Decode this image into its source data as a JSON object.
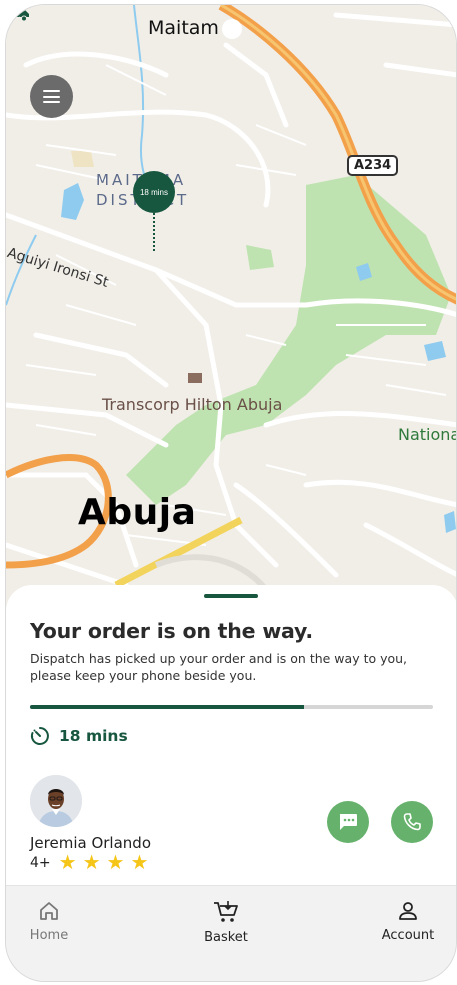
{
  "map": {
    "labels": {
      "maitam": "Maitam",
      "district": "MAITAMA\nDISTRICT",
      "street": "Aguiyi Ironsi St",
      "hotel": "Transcorp Hilton Abuja",
      "national": "Nationa",
      "city": "Abuja",
      "road_shield": "A234"
    },
    "eta_bubble": "18 mins",
    "menu_icon": "menu-icon",
    "courier_icon": "truck-icon"
  },
  "sheet": {
    "title": "Your order is on the way.",
    "subtitle": "Dispatch has picked up your order and is on the way to you, please keep your phone beside you.",
    "progress_fraction": 0.68,
    "eta": "18 mins",
    "eta_icon": "timer-icon",
    "driver": {
      "name": "Jeremia Orlando",
      "rating": "4+",
      "stars": 4
    },
    "actions": {
      "chat_icon": "chat-icon",
      "call_icon": "phone-icon"
    }
  },
  "nav": {
    "items": [
      {
        "label": "Home",
        "icon": "home-icon"
      },
      {
        "label": "Basket",
        "icon": "basket-icon"
      },
      {
        "label": "Account",
        "icon": "user-icon"
      }
    ]
  },
  "colors": {
    "brand_green": "#17563f",
    "action_green": "#66b26c",
    "star": "#f5c518",
    "highway": "#f7a341"
  }
}
